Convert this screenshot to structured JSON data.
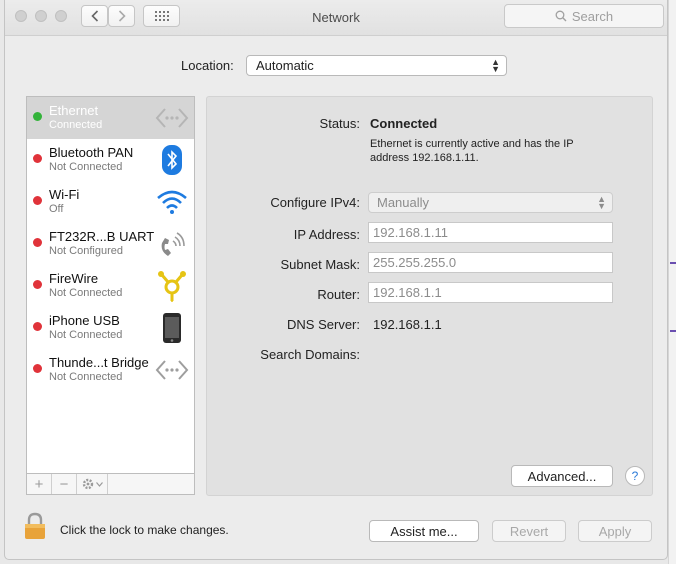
{
  "window": {
    "title": "Network"
  },
  "toolbar": {
    "search_placeholder": "Search"
  },
  "location": {
    "label": "Location:",
    "value": "Automatic"
  },
  "services": [
    {
      "name": "Ethernet",
      "status": "Connected",
      "state": "connected",
      "selected": true,
      "icon": "ethernet-icon"
    },
    {
      "name": "Bluetooth PAN",
      "status": "Not Connected",
      "state": "disconnected",
      "icon": "bluetooth-icon"
    },
    {
      "name": "Wi-Fi",
      "status": "Off",
      "state": "disconnected",
      "icon": "wifi-icon"
    },
    {
      "name": "FT232R...B UART",
      "status": "Not Configured",
      "state": "disconnected",
      "icon": "phone-modem-icon"
    },
    {
      "name": "FireWire",
      "status": "Not Connected",
      "state": "disconnected",
      "icon": "firewire-icon"
    },
    {
      "name": "iPhone USB",
      "status": "Not Connected",
      "state": "disconnected",
      "icon": "iphone-icon"
    },
    {
      "name": "Thunde...t Bridge",
      "status": "Not Connected",
      "state": "disconnected",
      "icon": "thunderbolt-bridge-icon"
    }
  ],
  "detail": {
    "status_label": "Status:",
    "status_value": "Connected",
    "status_desc_line1": "Ethernet is currently active and has the IP",
    "status_desc_line2": "address 192.168.1.11.",
    "configure_label": "Configure IPv4:",
    "configure_value": "Manually",
    "ip_label": "IP Address:",
    "ip_value": "192.168.1.11",
    "subnet_label": "Subnet Mask:",
    "subnet_value": "255.255.255.0",
    "router_label": "Router:",
    "router_value": "192.168.1.1",
    "dns_label": "DNS Server:",
    "dns_value": "192.168.1.1",
    "search_domains_label": "Search Domains:",
    "advanced_button": "Advanced...",
    "help_button": "?"
  },
  "footer": {
    "lock_text": "Click the lock to make changes.",
    "assist_button": "Assist me...",
    "revert_button": "Revert",
    "apply_button": "Apply"
  },
  "colors": {
    "connected": "#33b33a",
    "disconnected": "#e0333a",
    "selection": "#d5d5d5",
    "bluetooth": "#1e7be0",
    "wifi": "#1e7be0",
    "firewire": "#e6c414",
    "lock": "#e8a33a"
  }
}
